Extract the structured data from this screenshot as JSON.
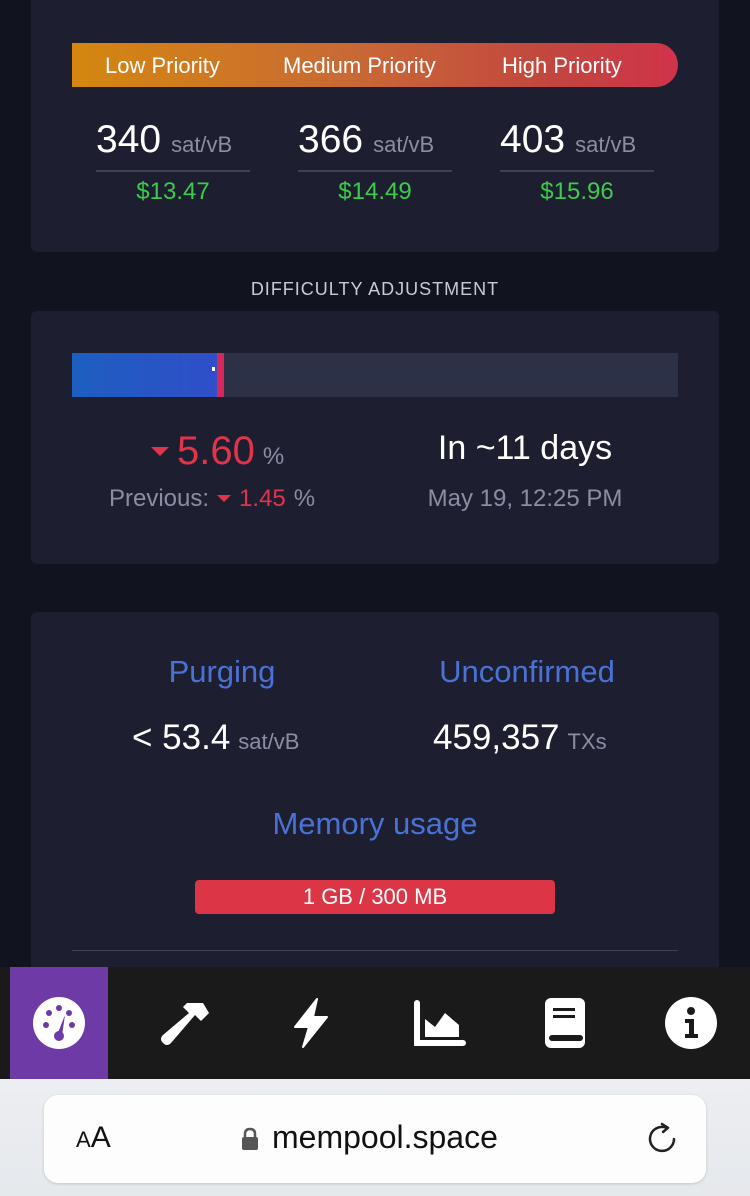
{
  "fees": {
    "labels": {
      "low": "Low Priority",
      "medium": "Medium Priority",
      "high": "High Priority"
    },
    "low": {
      "value": "340",
      "unit": "sat/vB",
      "usd": "$13.47"
    },
    "medium": {
      "value": "366",
      "unit": "sat/vB",
      "usd": "$14.49"
    },
    "high": {
      "value": "403",
      "unit": "sat/vB",
      "usd": "$15.96"
    }
  },
  "difficulty": {
    "title": "DIFFICULTY ADJUSTMENT",
    "progress_fraction": 0.24,
    "change_value": "5.60",
    "change_unit": "%",
    "previous_label": "Previous:",
    "previous_value": "1.45",
    "previous_unit": "%",
    "eta": "In ~11 days",
    "eta_date": "May 19, 12:25 PM"
  },
  "mempool": {
    "purging_label": "Purging",
    "purging_value": "< 53.4",
    "purging_unit": "sat/vB",
    "unconfirmed_label": "Unconfirmed",
    "unconfirmed_value": "459,357",
    "unconfirmed_unit": "TXs",
    "memory_label": "Memory usage",
    "memory_value": "1 GB / 300 MB"
  },
  "nav": {
    "items": [
      "dashboard-icon",
      "hammer-icon",
      "lightning-icon",
      "graph-icon",
      "docs-icon",
      "info-icon"
    ],
    "active": "dashboard-icon"
  },
  "browser": {
    "aa_small": "A",
    "aa_big": "A",
    "url": "mempool.space"
  },
  "colors": {
    "green": "#3bcc49",
    "red": "#e1334a",
    "blue_label": "#4a72d6",
    "nav_active": "#6d3aa6"
  }
}
